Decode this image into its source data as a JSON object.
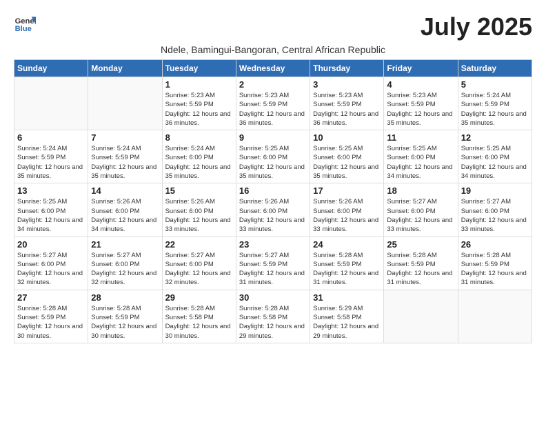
{
  "header": {
    "logo_general": "General",
    "logo_blue": "Blue",
    "month_year": "July 2025",
    "subtitle": "Ndele, Bamingui-Bangoran, Central African Republic"
  },
  "days_of_week": [
    "Sunday",
    "Monday",
    "Tuesday",
    "Wednesday",
    "Thursday",
    "Friday",
    "Saturday"
  ],
  "weeks": [
    [
      {
        "day": "",
        "info": ""
      },
      {
        "day": "",
        "info": ""
      },
      {
        "day": "1",
        "sunrise": "5:23 AM",
        "sunset": "5:59 PM",
        "daylight": "12 hours and 36 minutes."
      },
      {
        "day": "2",
        "sunrise": "5:23 AM",
        "sunset": "5:59 PM",
        "daylight": "12 hours and 36 minutes."
      },
      {
        "day": "3",
        "sunrise": "5:23 AM",
        "sunset": "5:59 PM",
        "daylight": "12 hours and 36 minutes."
      },
      {
        "day": "4",
        "sunrise": "5:23 AM",
        "sunset": "5:59 PM",
        "daylight": "12 hours and 35 minutes."
      },
      {
        "day": "5",
        "sunrise": "5:24 AM",
        "sunset": "5:59 PM",
        "daylight": "12 hours and 35 minutes."
      }
    ],
    [
      {
        "day": "6",
        "sunrise": "5:24 AM",
        "sunset": "5:59 PM",
        "daylight": "12 hours and 35 minutes."
      },
      {
        "day": "7",
        "sunrise": "5:24 AM",
        "sunset": "5:59 PM",
        "daylight": "12 hours and 35 minutes."
      },
      {
        "day": "8",
        "sunrise": "5:24 AM",
        "sunset": "6:00 PM",
        "daylight": "12 hours and 35 minutes."
      },
      {
        "day": "9",
        "sunrise": "5:25 AM",
        "sunset": "6:00 PM",
        "daylight": "12 hours and 35 minutes."
      },
      {
        "day": "10",
        "sunrise": "5:25 AM",
        "sunset": "6:00 PM",
        "daylight": "12 hours and 35 minutes."
      },
      {
        "day": "11",
        "sunrise": "5:25 AM",
        "sunset": "6:00 PM",
        "daylight": "12 hours and 34 minutes."
      },
      {
        "day": "12",
        "sunrise": "5:25 AM",
        "sunset": "6:00 PM",
        "daylight": "12 hours and 34 minutes."
      }
    ],
    [
      {
        "day": "13",
        "sunrise": "5:25 AM",
        "sunset": "6:00 PM",
        "daylight": "12 hours and 34 minutes."
      },
      {
        "day": "14",
        "sunrise": "5:26 AM",
        "sunset": "6:00 PM",
        "daylight": "12 hours and 34 minutes."
      },
      {
        "day": "15",
        "sunrise": "5:26 AM",
        "sunset": "6:00 PM",
        "daylight": "12 hours and 33 minutes."
      },
      {
        "day": "16",
        "sunrise": "5:26 AM",
        "sunset": "6:00 PM",
        "daylight": "12 hours and 33 minutes."
      },
      {
        "day": "17",
        "sunrise": "5:26 AM",
        "sunset": "6:00 PM",
        "daylight": "12 hours and 33 minutes."
      },
      {
        "day": "18",
        "sunrise": "5:27 AM",
        "sunset": "6:00 PM",
        "daylight": "12 hours and 33 minutes."
      },
      {
        "day": "19",
        "sunrise": "5:27 AM",
        "sunset": "6:00 PM",
        "daylight": "12 hours and 33 minutes."
      }
    ],
    [
      {
        "day": "20",
        "sunrise": "5:27 AM",
        "sunset": "6:00 PM",
        "daylight": "12 hours and 32 minutes."
      },
      {
        "day": "21",
        "sunrise": "5:27 AM",
        "sunset": "6:00 PM",
        "daylight": "12 hours and 32 minutes."
      },
      {
        "day": "22",
        "sunrise": "5:27 AM",
        "sunset": "6:00 PM",
        "daylight": "12 hours and 32 minutes."
      },
      {
        "day": "23",
        "sunrise": "5:27 AM",
        "sunset": "5:59 PM",
        "daylight": "12 hours and 31 minutes."
      },
      {
        "day": "24",
        "sunrise": "5:28 AM",
        "sunset": "5:59 PM",
        "daylight": "12 hours and 31 minutes."
      },
      {
        "day": "25",
        "sunrise": "5:28 AM",
        "sunset": "5:59 PM",
        "daylight": "12 hours and 31 minutes."
      },
      {
        "day": "26",
        "sunrise": "5:28 AM",
        "sunset": "5:59 PM",
        "daylight": "12 hours and 31 minutes."
      }
    ],
    [
      {
        "day": "27",
        "sunrise": "5:28 AM",
        "sunset": "5:59 PM",
        "daylight": "12 hours and 30 minutes."
      },
      {
        "day": "28",
        "sunrise": "5:28 AM",
        "sunset": "5:59 PM",
        "daylight": "12 hours and 30 minutes."
      },
      {
        "day": "29",
        "sunrise": "5:28 AM",
        "sunset": "5:58 PM",
        "daylight": "12 hours and 30 minutes."
      },
      {
        "day": "30",
        "sunrise": "5:28 AM",
        "sunset": "5:58 PM",
        "daylight": "12 hours and 29 minutes."
      },
      {
        "day": "31",
        "sunrise": "5:29 AM",
        "sunset": "5:58 PM",
        "daylight": "12 hours and 29 minutes."
      },
      {
        "day": "",
        "info": ""
      },
      {
        "day": "",
        "info": ""
      }
    ]
  ],
  "labels": {
    "sunrise_prefix": "Sunrise: ",
    "sunset_prefix": "Sunset: ",
    "daylight_prefix": "Daylight: "
  }
}
